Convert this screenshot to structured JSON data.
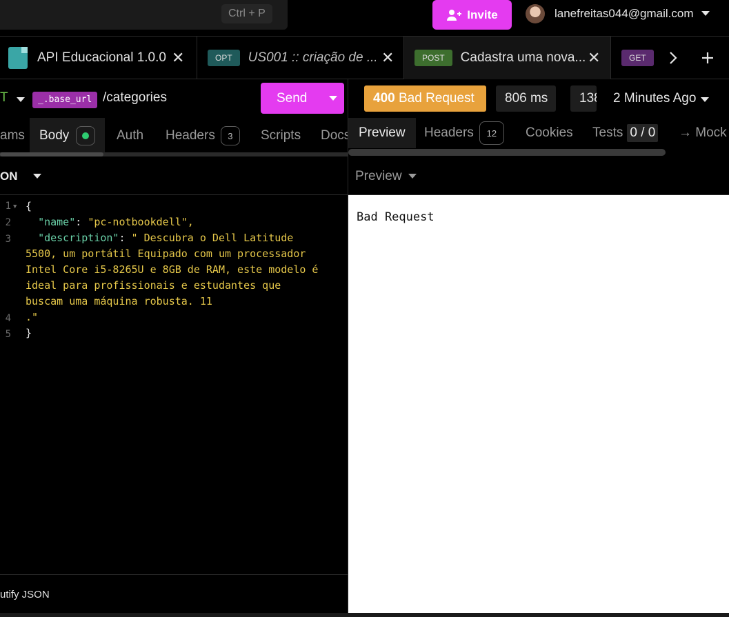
{
  "topbar": {
    "shortcut": "Ctrl + P",
    "invite_label": "Invite",
    "user_email": "lanefreitas044@gmail.com"
  },
  "tabs": [
    {
      "title": "API Educacional 1.0.0",
      "icon": "document-icon"
    },
    {
      "method": "OPT",
      "title": "US001 :: criação de ..."
    },
    {
      "method": "POST",
      "title": "Cadastra uma nova..."
    },
    {
      "method": "GET"
    }
  ],
  "request": {
    "method_partial": "T",
    "base_url_var": "_.base_url",
    "path": "/categories",
    "send_label": "Send",
    "tabs": {
      "params_partial": "ams",
      "body": "Body",
      "auth": "Auth",
      "headers": "Headers",
      "headers_count": "3",
      "scripts": "Scripts",
      "docs_partial": "Docs"
    },
    "body_format_partial": "ON",
    "beautify_partial": "utify JSON"
  },
  "editor": {
    "lines": [
      {
        "n": "1",
        "code": "{"
      },
      {
        "n": "2",
        "key": "\"name\"",
        "value": "\"pc-notbookdell\","
      },
      {
        "n": "3",
        "key": "\"description\"",
        "value": "\" Descubra o Dell Latitude"
      },
      {
        "n": "",
        "cont": "5500, um portátil Equipado com um processador"
      },
      {
        "n": "",
        "cont": "Intel Core i5-8265U e 8GB de RAM, este modelo é"
      },
      {
        "n": "",
        "cont": "ideal para profissionais e estudantes que"
      },
      {
        "n": "",
        "cont": "buscam uma máquina robusta. 11"
      },
      {
        "n": "4",
        "cont": ".\""
      },
      {
        "n": "5",
        "code": "}"
      }
    ]
  },
  "response": {
    "status_code": "400",
    "status_text": "Bad Request",
    "time": "806 ms",
    "size_partial": "138",
    "time_ago": "2 Minutes Ago",
    "tabs": {
      "preview": "Preview",
      "headers": "Headers",
      "headers_count": "12",
      "cookies": "Cookies",
      "tests": "Tests",
      "tests_value": "0 / 0",
      "mock_partial": "→ Mock"
    },
    "preview_mode": "Preview",
    "body": "Bad Request"
  },
  "colors": {
    "accent": "#e43bf0",
    "status_error": "#e8a23c",
    "method_post": "#3d6e2e",
    "method_opt": "#1f5a5a",
    "method_get": "#5a2a6e"
  }
}
